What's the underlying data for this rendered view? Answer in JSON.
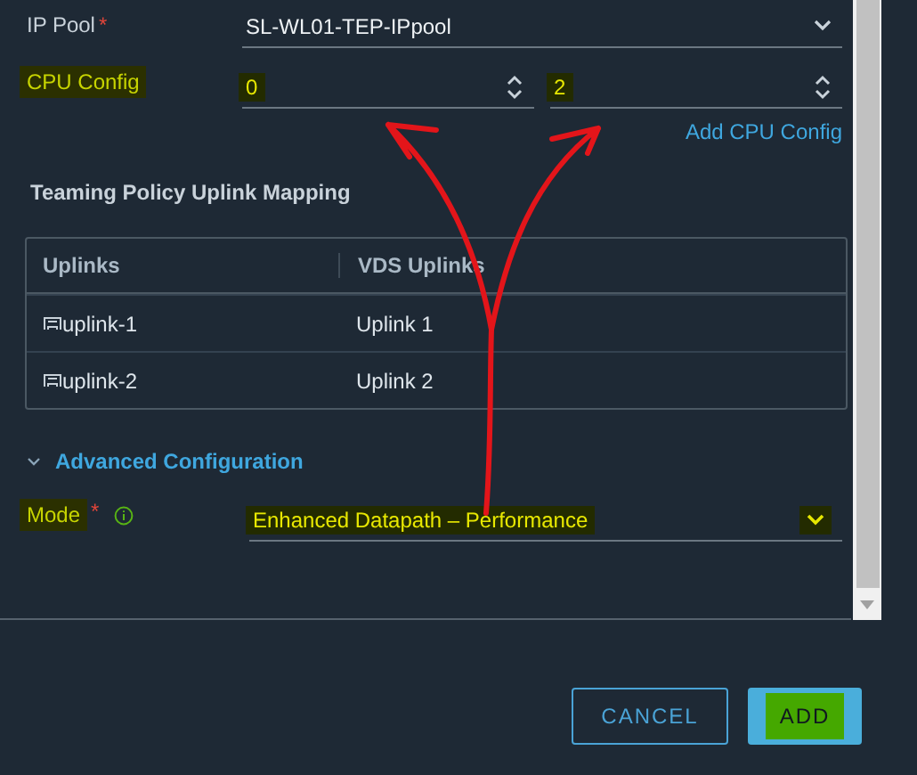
{
  "ip_pool": {
    "label": "IP Pool",
    "required_mark": "*",
    "value": "SL-WL01-TEP-IPpool"
  },
  "cpu_config": {
    "label": "CPU Config",
    "highlighted": true,
    "fields": [
      {
        "value": "0",
        "highlighted": true
      },
      {
        "value": "2",
        "highlighted": true
      }
    ],
    "add_link": "Add CPU Config"
  },
  "teaming": {
    "title": "Teaming Policy Uplink Mapping",
    "columns": [
      "Uplinks",
      "VDS Uplinks"
    ],
    "rows": [
      [
        "uplink-1",
        "Uplink 1"
      ],
      [
        "uplink-2",
        "Uplink 2"
      ]
    ]
  },
  "advanced": {
    "title": "Advanced Configuration",
    "expanded": true
  },
  "mode": {
    "label": "Mode",
    "required_mark": "*",
    "highlighted": true,
    "value": "Enhanced Datapath – Performance"
  },
  "buttons": [
    {
      "label": "CANCEL",
      "kind": "secondary",
      "highlighted": false
    },
    {
      "label": "ADD",
      "kind": "primary",
      "highlighted": true
    }
  ]
}
